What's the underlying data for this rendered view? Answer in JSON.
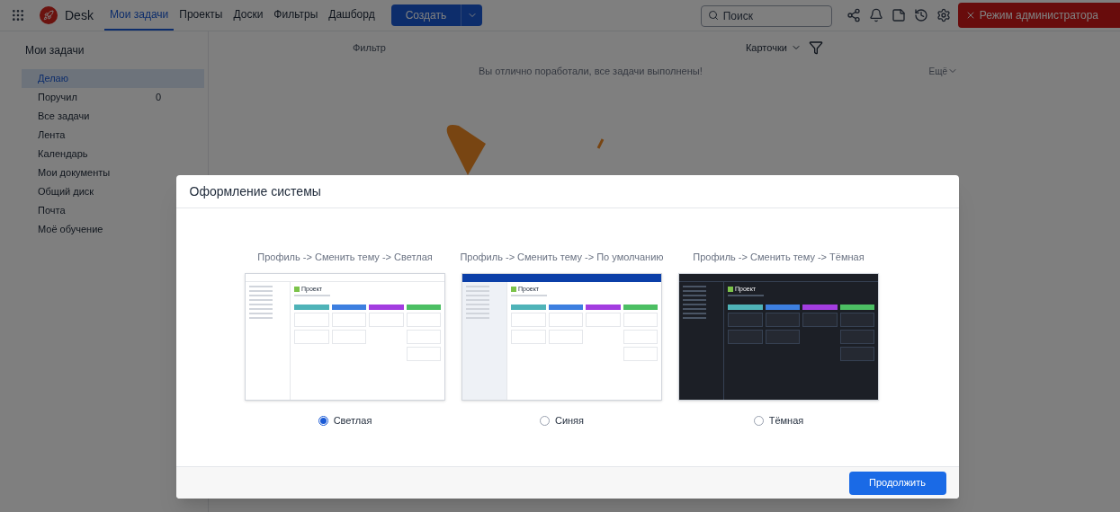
{
  "topbar": {
    "app_name": "Desk",
    "nav": [
      {
        "label": "Мои задачи",
        "selected": true
      },
      {
        "label": "Проекты",
        "selected": false
      },
      {
        "label": "Доски",
        "selected": false
      },
      {
        "label": "Фильтры",
        "selected": false
      },
      {
        "label": "Дашборд",
        "selected": false
      }
    ],
    "create_button": "Создать",
    "search": {
      "placeholder": "Поиск"
    },
    "admin_button": "Режим администратора"
  },
  "sidebar": {
    "title": "Мои задачи",
    "items": [
      {
        "label": "Делаю",
        "selected": true
      },
      {
        "label": "Поручил",
        "count": "0",
        "selected": false
      },
      {
        "label": "Все задачи",
        "selected": false
      },
      {
        "label": "Лента",
        "selected": false
      },
      {
        "label": "Календарь",
        "selected": false
      },
      {
        "label": "Мои документы",
        "selected": false
      },
      {
        "label": "Общий диск",
        "selected": false
      },
      {
        "label": "Почта",
        "selected": false
      },
      {
        "label": "Моё обучение",
        "selected": false
      }
    ]
  },
  "main": {
    "filter_label": "Фильтр",
    "view_selector": "Карточки",
    "empty_message": "Вы отлично поработали, все задачи выполнены!",
    "more_link": "Ещё"
  },
  "dialog": {
    "title": "Оформление системы",
    "themes": [
      {
        "caption": "Профиль -> Сменить тему -> Светлая",
        "kind": "light",
        "preview_title": "Проект",
        "label": "Светлая",
        "selected": true
      },
      {
        "caption": "Профиль -> Сменить тему -> По умолчанию",
        "kind": "blue",
        "preview_title": "Проект",
        "label": "Синяя",
        "selected": false
      },
      {
        "caption": "Профиль -> Сменить тему -> Тёмная",
        "kind": "dark",
        "preview_title": "Проект",
        "label": "Тёмная",
        "selected": false
      }
    ],
    "continue_button": "Продолжить"
  }
}
